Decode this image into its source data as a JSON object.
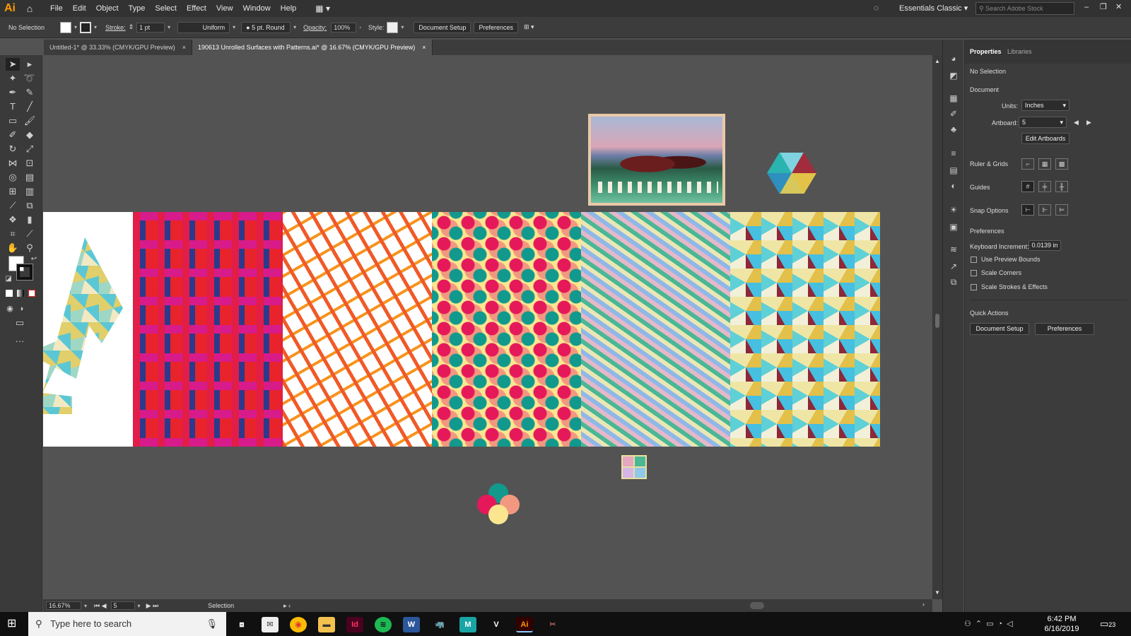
{
  "app": {
    "logo": "Ai",
    "workspace": "Essentials Classic",
    "stock_search_placeholder": "Search Adobe Stock"
  },
  "menu": [
    "File",
    "Edit",
    "Object",
    "Type",
    "Select",
    "Effect",
    "View",
    "Window",
    "Help"
  ],
  "control_bar": {
    "selection": "No Selection",
    "stroke_label": "Stroke:",
    "stroke_value": "1 pt",
    "profile": "Uniform",
    "brush": "5 pt. Round",
    "opacity_label": "Opacity:",
    "opacity_value": "100%",
    "style_label": "Style:",
    "document_setup": "Document Setup",
    "preferences": "Preferences"
  },
  "tabs": [
    {
      "label": "Untitled-1* @ 33.33% (CMYK/GPU Preview)",
      "close": "×"
    },
    {
      "label": "190613 Unrolled Surfaces with Patterns.ai* @ 16.67% (CMYK/GPU Preview)",
      "close": "×"
    }
  ],
  "panel": {
    "tab_properties": "Properties",
    "tab_libraries": "Libraries",
    "no_selection": "No Selection",
    "document_heading": "Document",
    "units_label": "Units:",
    "units_value": "Inches",
    "artboard_label": "Artboard:",
    "artboard_value": "5",
    "edit_artboards": "Edit Artboards",
    "rulers_grids": "Ruler & Grids",
    "guides": "Guides",
    "snap_options": "Snap Options",
    "preferences_heading": "Preferences",
    "keyboard_increment_label": "Keyboard Increment:",
    "keyboard_increment_value": "0.0139 in",
    "use_preview_bounds": "Use Preview Bounds",
    "scale_corners": "Scale Corners",
    "scale_strokes": "Scale Strokes & Effects",
    "quick_actions": "Quick Actions",
    "qa_document_setup": "Document Setup",
    "qa_preferences": "Preferences"
  },
  "status": {
    "zoom": "16.67%",
    "artboard": "5",
    "tool": "Selection"
  },
  "taskbar": {
    "search_placeholder": "Type here to search",
    "time": "6:42 PM",
    "date": "6/16/2019",
    "notifications": "23"
  },
  "colors": {
    "chrome_dark": "#323232",
    "canvas": "#535353",
    "panel": "#3c3c3c",
    "accent": "#ff9a00"
  },
  "icons": [
    "home-icon",
    "lightbulb-icon",
    "search-icon",
    "selection-tool-icon",
    "direct-selection-icon",
    "pen-icon",
    "type-icon",
    "rectangle-icon",
    "paintbrush-icon",
    "eraser-icon",
    "rotate-icon",
    "scale-icon",
    "gradient-icon",
    "eyedropper-icon",
    "hand-icon",
    "zoom-icon",
    "windows-start-icon",
    "microphone-icon"
  ]
}
